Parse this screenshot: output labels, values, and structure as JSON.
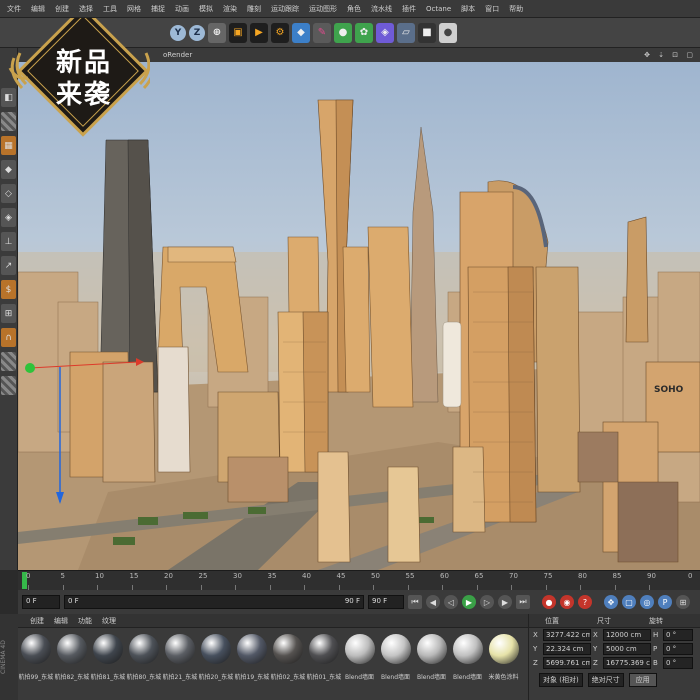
{
  "menu": [
    "文件",
    "编辑",
    "创建",
    "选择",
    "工具",
    "网格",
    "捕捉",
    "动画",
    "模拟",
    "渲染",
    "雕刻",
    "运动跟踪",
    "运动图形",
    "角色",
    "流水线",
    "插件",
    "Octane",
    "脚本",
    "窗口",
    "帮助"
  ],
  "promo": {
    "line1": "新品",
    "line2": "来袭"
  },
  "toolbar": {
    "axis_labels": [
      "Y",
      "Z"
    ]
  },
  "viewport": {
    "header_label": "oRender",
    "soho_label": "SOHO"
  },
  "timeline": {
    "ticks": [
      "0",
      "5",
      "10",
      "15",
      "20",
      "25",
      "30",
      "35",
      "40",
      "45",
      "50",
      "55",
      "60",
      "65",
      "70",
      "75",
      "80",
      "85",
      "90"
    ],
    "end_label": "0"
  },
  "transport": {
    "start_frame": "0 F",
    "current_frame": "0 F",
    "range_end": "90 F",
    "end_frame": "90 F"
  },
  "materials": {
    "tabs": [
      "创建",
      "编辑",
      "功能",
      "纹理"
    ],
    "items": [
      {
        "label": "航拍99_东城",
        "color": "#4a4e55"
      },
      {
        "label": "航拍82_东城",
        "color": "#565a60"
      },
      {
        "label": "航拍81_东城",
        "color": "#3f454d"
      },
      {
        "label": "航拍80_东城",
        "color": "#4d5259"
      },
      {
        "label": "航拍21_东城",
        "color": "#5b5e64"
      },
      {
        "label": "航拍20_东城",
        "color": "#47505e"
      },
      {
        "label": "航拍19_东城",
        "color": "#525866"
      },
      {
        "label": "航拍02_东城",
        "color": "#555250"
      },
      {
        "label": "航拍01_东城",
        "color": "#4f4f52"
      },
      {
        "label": "Blend墙面",
        "color": "#bdbdbd"
      },
      {
        "label": "Blend墙面",
        "color": "#c4c4c4"
      },
      {
        "label": "Blend墙面",
        "color": "#b8b8b8"
      },
      {
        "label": "Blend墙面",
        "color": "#c0c0c0"
      },
      {
        "label": "米黄色涂料",
        "color": "#e6e2a8"
      }
    ]
  },
  "coordinates": {
    "headers": [
      "位置",
      "尺寸",
      "旋转"
    ],
    "rows": [
      {
        "axis": "X",
        "pos": "3277.422 cm",
        "size_axis": "X",
        "size": "12000 cm",
        "rot_axis": "H",
        "rot": "0 °"
      },
      {
        "axis": "Y",
        "pos": "22.324 cm",
        "size_axis": "Y",
        "size": "5000 cm",
        "rot_axis": "P",
        "rot": "0 °"
      },
      {
        "axis": "Z",
        "pos": "5699.761 cm",
        "size_axis": "Z",
        "size": "16775.369 cm",
        "rot_axis": "B",
        "rot": "0 °"
      }
    ],
    "mode": "对象 (相对)",
    "size_mode": "绝对尺寸",
    "apply": "应用"
  },
  "brand": "CINEMA 4D"
}
